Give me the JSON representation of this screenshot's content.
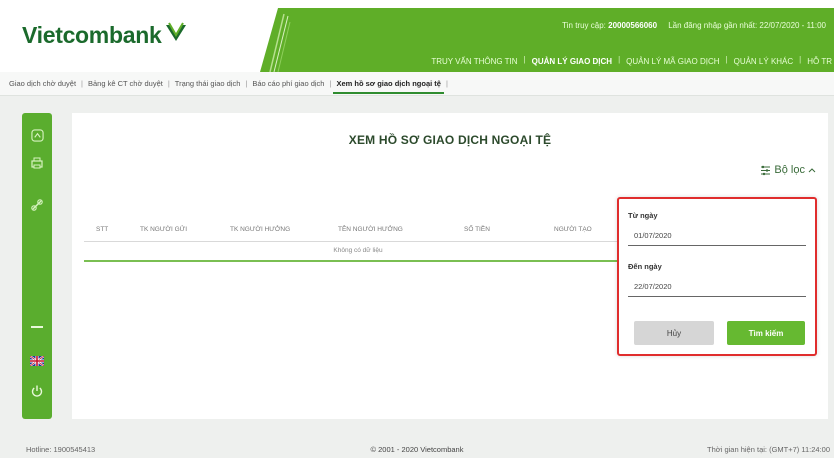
{
  "brand": {
    "name": "Vietcombank",
    "color": "#1b6a2c",
    "accent": "#5fae28"
  },
  "header": {
    "greeting_label": "Tin truy cập:",
    "user_id": "20000566060",
    "last_login_label": "Lần đăng nhập gần nhất:",
    "last_login_value": "22/07/2020 - 11:00",
    "nav": [
      {
        "label": "TRUY VẤN THÔNG TIN",
        "active": false
      },
      {
        "label": "QUẢN LÝ GIAO DỊCH",
        "active": true
      },
      {
        "label": "QUẢN LÝ MÃ GIAO DỊCH",
        "active": false
      },
      {
        "label": "QUẢN LÝ KHÁC",
        "active": false
      },
      {
        "label": "HỖ TR",
        "active": false
      }
    ]
  },
  "subnav": [
    {
      "label": "Giao dịch chờ duyệt",
      "active": false
    },
    {
      "label": "Bảng kê CT chờ duyệt",
      "active": false
    },
    {
      "label": "Trạng thái giao dịch",
      "active": false
    },
    {
      "label": "Báo cáo phí giao dịch",
      "active": false
    },
    {
      "label": "Xem hồ sơ giao dịch ngoại tệ",
      "active": true
    }
  ],
  "sidebar": {
    "icons": [
      "home-icon",
      "printer-icon",
      "link-icon",
      "minus-icon",
      "uk-flag-icon",
      "power-icon"
    ]
  },
  "main": {
    "title": "XEM HỒ SƠ GIAO DỊCH NGOẠI TỆ",
    "filter_toggle_label": "Bộ lọc",
    "columns": [
      "STT",
      "TK NGƯỜI GỬI",
      "TK NGƯỜI HƯỞNG",
      "TÊN NGƯỜI HƯỞNG",
      "SỐ TIỀN",
      "NGƯỜI TẠO"
    ],
    "empty_text": "Không có dữ liệu"
  },
  "filter": {
    "from_label": "Từ ngày",
    "from_value": "01/07/2020",
    "to_label": "Đến ngày",
    "to_value": "22/07/2020",
    "cancel_label": "Hủy",
    "search_label": "Tìm kiếm",
    "highlight_color": "#e02d2d"
  },
  "footer": {
    "hotline": "Hotline: 1900545413",
    "copyright": "© 2001 - 2020 Vietcombank",
    "server_time": "Thời gian hiện tại: (GMT+7) 11:24:00"
  }
}
